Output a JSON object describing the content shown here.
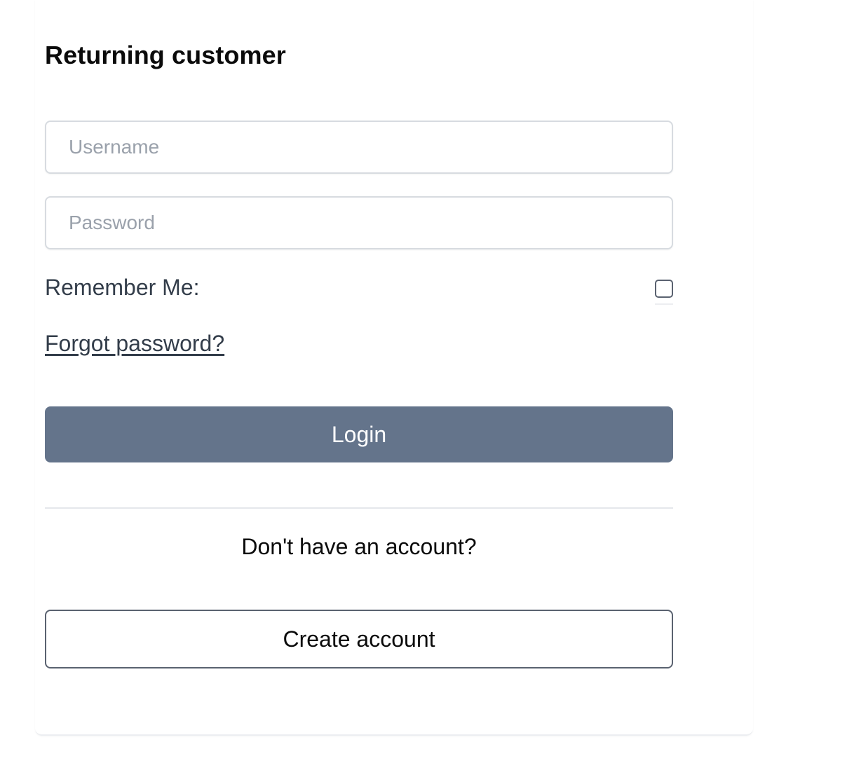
{
  "form": {
    "title": "Returning customer",
    "username": {
      "placeholder": "Username",
      "value": ""
    },
    "password": {
      "placeholder": "Password",
      "value": ""
    },
    "remember_label": "Remember Me:",
    "remember_checked": false,
    "forgot_link": "Forgot password?",
    "login_label": "Login",
    "no_account_text": "Don't have an account?",
    "create_account_label": "Create account"
  },
  "colors": {
    "primary_button": "#64748b",
    "text": "#0b0b0b",
    "muted_text": "#333d4a",
    "placeholder": "#9aa1ab",
    "border": "#d7dbe0"
  }
}
